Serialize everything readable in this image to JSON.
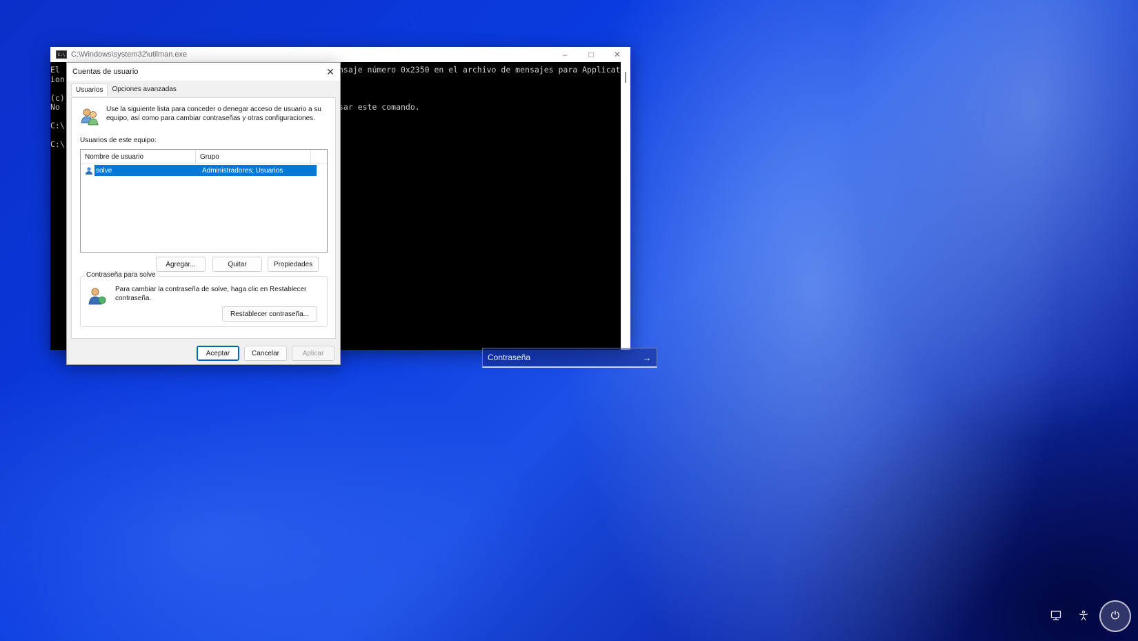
{
  "console": {
    "title": "C:\\Windows\\system32\\utilman.exe",
    "lines": [
      "El",
      "ion",
      "(c)",
      "No",
      "C:\\",
      "C:\\"
    ],
    "right_lines": [
      "nsaje número 0x2350 en el archivo de mensajes para Applicat",
      "sar este comando."
    ]
  },
  "dialog": {
    "title": "Cuentas de usuario",
    "tabs": [
      "Usuarios",
      "Opciones avanzadas"
    ],
    "info_text": "Use la siguiente lista para conceder o denegar acceso de usuario a su equipo, así como para cambiar contraseñas y otras configuraciones.",
    "users_label": "Usuarios de este equipo:",
    "columns": [
      "Nombre de usuario",
      "Grupo"
    ],
    "rows": [
      {
        "name": "solve",
        "group": "Administradores; Usuarios"
      }
    ],
    "buttons": {
      "add": "Agregar...",
      "remove": "Quitar",
      "properties": "Propiedades",
      "reset": "Restablecer contraseña...",
      "ok": "Aceptar",
      "cancel": "Cancelar",
      "apply": "Aplicar"
    },
    "password_group": {
      "legend": "Contraseña para solve",
      "text": "Para cambiar la contraseña de solve, haga clic en Restablecer contraseña."
    }
  },
  "login": {
    "password_placeholder": "Contraseña"
  },
  "colors": {
    "selection": "#0078d7",
    "accent": "#0067c0"
  },
  "icons": [
    "console-icon",
    "users-icon",
    "user-row-icon",
    "password-user-icon",
    "submit-arrow-icon",
    "network-icon",
    "accessibility-icon",
    "power-icon"
  ]
}
